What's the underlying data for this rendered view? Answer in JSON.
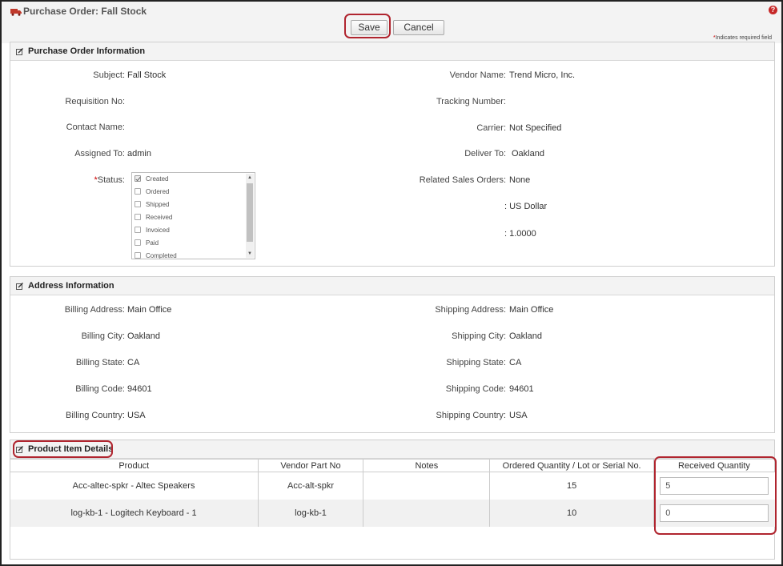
{
  "window": {
    "title": "Purchase Order: Fall Stock",
    "help_icon": "question-icon",
    "title_icon": "truck-icon"
  },
  "toolbar": {
    "save_label": "Save",
    "cancel_label": "Cancel",
    "required_note_star": "*",
    "required_note": "Indicates required field"
  },
  "po_info": {
    "section_title": "Purchase Order Information",
    "subject_label": "Subject:",
    "subject_value": "Fall Stock",
    "requisition_label": "Requisition No:",
    "requisition_value": "",
    "contact_label": "Contact Name:",
    "contact_value": "",
    "assigned_label": "Assigned To:",
    "assigned_value": "admin",
    "status_star": "*",
    "status_label": "Status:",
    "status_options": [
      {
        "label": "Created",
        "checked": true
      },
      {
        "label": "Ordered",
        "checked": false
      },
      {
        "label": "Shipped",
        "checked": false
      },
      {
        "label": "Received",
        "checked": false
      },
      {
        "label": "Invoiced",
        "checked": false
      },
      {
        "label": "Paid",
        "checked": false
      },
      {
        "label": "Completed",
        "checked": false
      }
    ],
    "vendor_label": "Vendor Name:",
    "vendor_value": "Trend Micro, Inc.",
    "tracking_label": "Tracking Number:",
    "tracking_value": "",
    "carrier_label": "Carrier:",
    "carrier_value": "Not Specified",
    "deliver_label": "Deliver To:",
    "deliver_value": "Oakland",
    "related_label": "Related Sales Orders:",
    "related_value": "None",
    "currency_value": ": US Dollar",
    "rate_value": ": 1.0000"
  },
  "address": {
    "section_title": "Address Information",
    "billing_address_label": "Billing Address:",
    "billing_address_value": "Main Office",
    "billing_city_label": "Billing City:",
    "billing_city_value": "Oakland",
    "billing_state_label": "Billing State:",
    "billing_state_value": "CA",
    "billing_code_label": "Billing Code:",
    "billing_code_value": "94601",
    "billing_country_label": "Billing Country:",
    "billing_country_value": "USA",
    "shipping_address_label": "Shipping Address:",
    "shipping_address_value": "Main Office",
    "shipping_city_label": "Shipping City:",
    "shipping_city_value": "Oakland",
    "shipping_state_label": "Shipping State:",
    "shipping_state_value": "CA",
    "shipping_code_label": "Shipping Code:",
    "shipping_code_value": "94601",
    "shipping_country_label": "Shipping Country:",
    "shipping_country_value": "USA"
  },
  "products": {
    "section_title": "Product Item Details",
    "columns": [
      "Product",
      "Vendor Part No",
      "Notes",
      "Ordered Quantity / Lot or Serial No.",
      "Received Quantity"
    ],
    "rows": [
      {
        "product": "Acc-altec-spkr - Altec Speakers",
        "vendor_part": "Acc-alt-spkr",
        "notes": "",
        "ordered": "15",
        "received": "5"
      },
      {
        "product": "log-kb-1 - Logitech Keyboard - 1",
        "vendor_part": "log-kb-1",
        "notes": "",
        "ordered": "10",
        "received": "0"
      }
    ]
  },
  "colors": {
    "callout": "#b0252f",
    "header_bg": "#f3f3f3",
    "required": "#cc0000"
  }
}
